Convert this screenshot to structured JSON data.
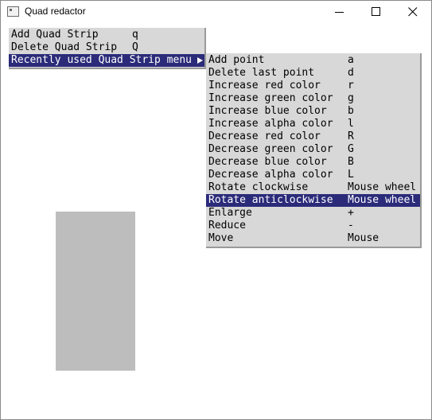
{
  "window": {
    "title": "Quad redactor",
    "icon": "app-window-icon"
  },
  "title_controls": [
    "minimize-icon",
    "maximize-icon",
    "close-icon"
  ],
  "colors": {
    "selection": "#2b2b7a",
    "menu_bg": "#d8d8d8",
    "shape": "#bdbdbd"
  },
  "menu1": {
    "items": [
      {
        "label": "Add Quad Strip",
        "key": "q"
      },
      {
        "label": "Delete Quad Strip",
        "key": "Q"
      },
      {
        "label": "Recently used Quad Strip menu",
        "key": ""
      }
    ]
  },
  "menu2": {
    "items": [
      {
        "label": "Add point",
        "key": "a"
      },
      {
        "label": "Delete last point",
        "key": "d"
      },
      {
        "label": "Increase red color",
        "key": "r"
      },
      {
        "label": "Increase green color",
        "key": "g"
      },
      {
        "label": "Increase blue color",
        "key": "b"
      },
      {
        "label": "Increase alpha color",
        "key": "l"
      },
      {
        "label": "Decrease red color",
        "key": "R"
      },
      {
        "label": "Decrease green color",
        "key": "G"
      },
      {
        "label": "Decrease blue color",
        "key": "B"
      },
      {
        "label": "Decrease alpha color",
        "key": "L"
      },
      {
        "label": "Rotate clockwise",
        "key": "Mouse wheel"
      },
      {
        "label": "Rotate anticlockwise",
        "key": "Mouse wheel"
      },
      {
        "label": "Enlarge",
        "key": "+"
      },
      {
        "label": "Reduce",
        "key": "-"
      },
      {
        "label": "Move",
        "key": "Mouse"
      }
    ]
  }
}
